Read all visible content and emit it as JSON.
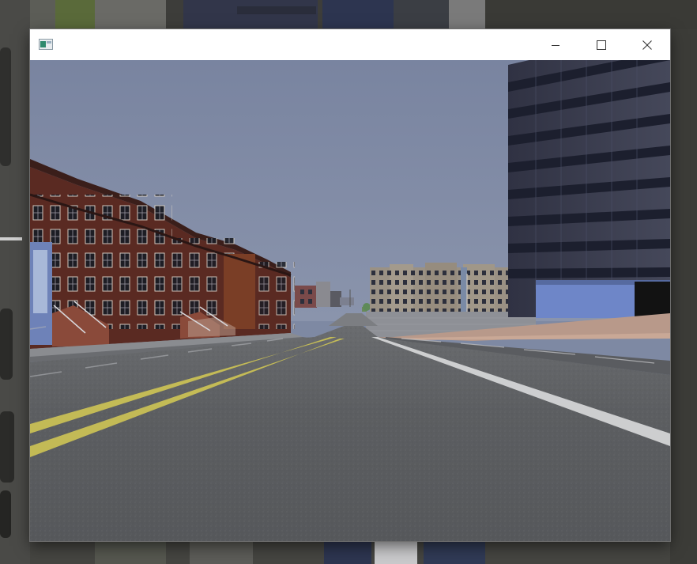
{
  "window": {
    "title": "",
    "icon": "app-window-icon",
    "controls": [
      "minimize-icon",
      "maximize-icon",
      "close-icon"
    ]
  },
  "scene": {
    "description_type": "3d-driving-simulator-camera-view",
    "sky_color": "#7e89a3",
    "road_color": "#5e6063",
    "center_line_color": "#cfc555",
    "lane_line_color": "#d9dadc",
    "brick_color": "#5a2a22",
    "office_tower_color": "#3d3f4d"
  },
  "desktop": {
    "background_color": "#3f3f3b"
  }
}
